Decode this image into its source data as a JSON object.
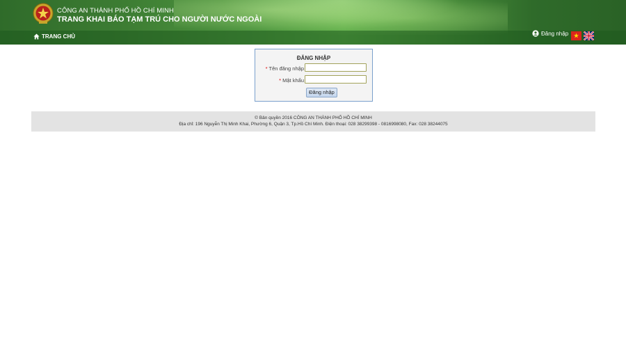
{
  "header": {
    "org_name": "CÔNG AN THÀNH PHỐ HỒ CHÍ MINH",
    "site_title": "TRANG KHAI BÁO TẠM TRÚ CHO NGƯỜI NƯỚC NGOÀI",
    "nav_home": "TRANG CHỦ",
    "login_link": "Đăng nhập"
  },
  "login": {
    "title": "ĐĂNG NHẬP",
    "required_mark": "*",
    "username_label": "Tên đăng nhập",
    "username_value": "",
    "password_label": "Mật khẩu",
    "password_value": "",
    "submit_label": "Đăng nhập"
  },
  "footer": {
    "copyright": "© Bản quyền 2016 CÔNG AN THÀNH PHỐ HỒ CHÍ MINH",
    "address": "Địa chỉ: 196 Nguyễn Thị Minh Khai, Phường 6, Quận 3, Tp.Hồ Chí Minh. Điện thoại: 028 38299398 - 0816998080, Fax: 028 38244075"
  },
  "icons": {
    "logo": "police-emblem-icon",
    "home": "home-icon",
    "user": "user-icon",
    "flag_vn": "vietnam-flag-icon",
    "flag_en": "uk-flag-icon"
  },
  "colors": {
    "header_green": "#3d7d33",
    "box_border": "#7aa0cc",
    "footer_bg": "#e3e3e3",
    "required": "#dd0000"
  }
}
